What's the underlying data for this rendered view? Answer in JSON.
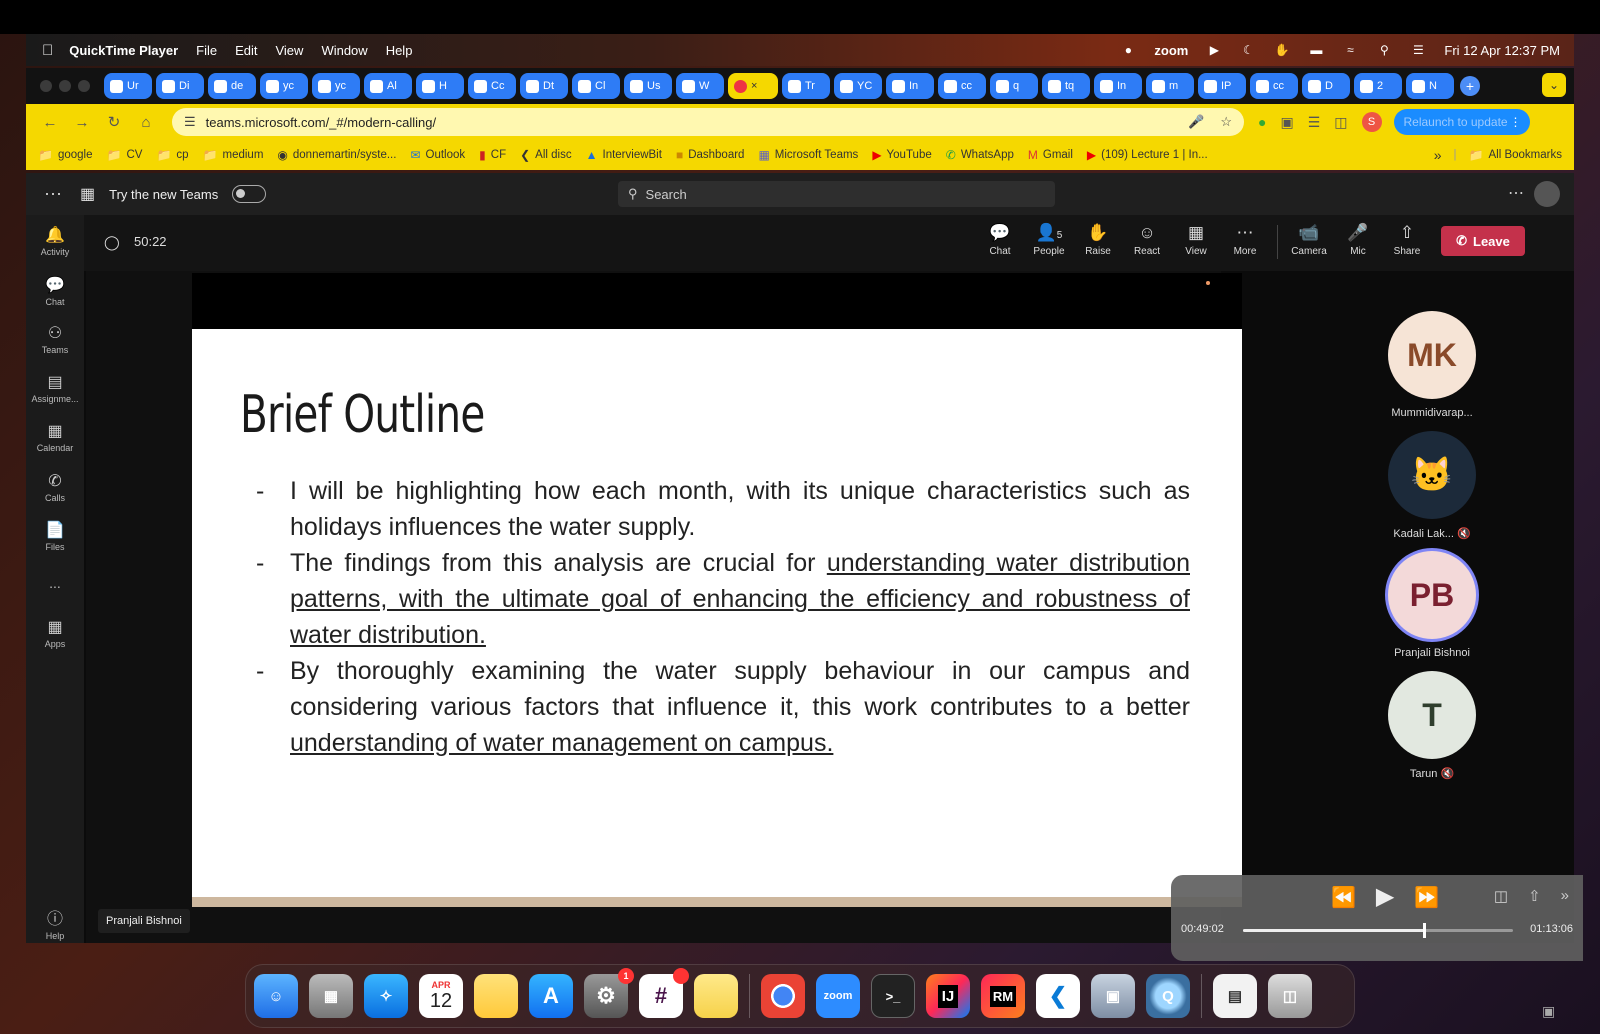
{
  "menubar": {
    "app_name": "QuickTime Player",
    "menus": [
      "File",
      "Edit",
      "View",
      "Window",
      "Help"
    ],
    "zoom_label": "zoom",
    "datetime": "Fri 12 Apr  12:37 PM"
  },
  "tabs": [
    "Ur",
    "Di",
    "de",
    "yc",
    "yc",
    "Al",
    "H",
    "Cc",
    "Dt",
    "Cl",
    "Us",
    "W",
    "",
    "Tr",
    "YC",
    "In",
    "cc",
    "q",
    "tq",
    "In",
    "m",
    "IP",
    "cc",
    "D",
    "2",
    "N"
  ],
  "address": {
    "url": "teams.microsoft.com/_#/modern-calling/",
    "relaunch_label": "Relaunch to update",
    "profile_initial": "S"
  },
  "bookmarks": {
    "items": [
      "google",
      "CV",
      "cp",
      "medium",
      "donnemartin/syste...",
      "Outlook",
      "CF",
      "All disc",
      "InterviewBit",
      "Dashboard",
      "Microsoft Teams",
      "YouTube",
      "WhatsApp",
      "Gmail",
      "(109) Lecture 1 | In..."
    ],
    "overflow": "»",
    "all_bookmarks": "All Bookmarks"
  },
  "teams": {
    "try_new": "Try the new Teams",
    "search_placeholder": "Search",
    "rail": [
      "Activity",
      "Chat",
      "Teams",
      "Assignme...",
      "Calendar",
      "Calls",
      "Files",
      "...",
      "Apps",
      "Help"
    ],
    "timer": "50:22",
    "controls": {
      "chat": "Chat",
      "people": "People",
      "people_count": "5",
      "raise": "Raise",
      "react": "React",
      "view": "View",
      "more": "More",
      "camera": "Camera",
      "mic": "Mic",
      "share": "Share",
      "leave": "Leave"
    },
    "presenter_tag": "Pranjali Bishnoi"
  },
  "slide": {
    "title": "Brief Outline",
    "bullet_dash": "-",
    "b1": "I will be highlighting how each month, with its unique characteristics such as holidays influences the water supply.",
    "b2_pre": "The findings from this analysis are crucial for ",
    "b2_u": "understanding water distribution patterns, with the ultimate goal of enhancing the efficiency and robustness of water distribution.",
    "b3_pre": "By thoroughly examining the water supply behaviour in our campus and considering various factors that influence it, this work contributes to a better ",
    "b3_u": "understanding of water management on campus."
  },
  "participants": [
    {
      "initials": "MK",
      "name": "Mummidivarap...",
      "bg": "#f6e4d6",
      "fg": "#8a4a2a"
    },
    {
      "initials": "",
      "name": "Kadali Lak...",
      "bg": "#1c2a3a",
      "fg": "#fff"
    },
    {
      "initials": "PB",
      "name": "Pranjali Bishnoi",
      "bg": "#f3d9d9",
      "fg": "#7a2030"
    },
    {
      "initials": "T",
      "name": "Tarun",
      "bg": "#e2e8e0",
      "fg": "#2f3e2d"
    }
  ],
  "quicktime": {
    "current": "00:49:02",
    "total": "01:13:06",
    "progress": 0.67
  },
  "dock": {
    "calendar_month": "APR",
    "calendar_day": "12",
    "settings_badge": "1",
    "zoom_label": "zoom",
    "terminal_label": ">_",
    "intellij_label": "IJ",
    "rubymine_label": "RM"
  },
  "colors": {
    "chrome_yellow": "#f5d800",
    "teams_leave": "#c4314b",
    "tab_blue": "#2e7cf6"
  }
}
